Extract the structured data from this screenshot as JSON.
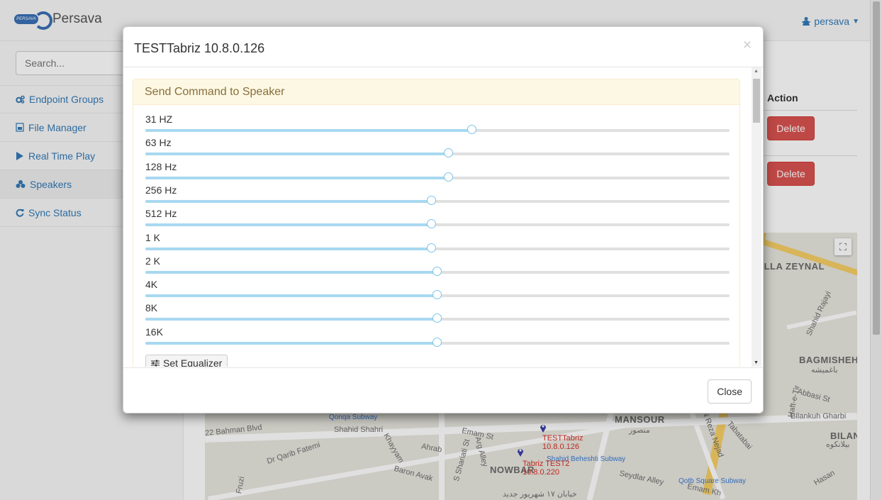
{
  "app": {
    "brand_logo_text": "PERSAVA",
    "brand_name": "Persava",
    "user": "persava"
  },
  "sidebar": {
    "search_placeholder": "Search...",
    "items": [
      {
        "label": "Endpoint Groups",
        "icon": "cogs-icon"
      },
      {
        "label": "File Manager",
        "icon": "file-icon"
      },
      {
        "label": "Real Time Play",
        "icon": "play-icon"
      },
      {
        "label": "Speakers",
        "icon": "speaker-icon",
        "active": true
      },
      {
        "label": "Sync Status",
        "icon": "refresh-icon"
      }
    ]
  },
  "table": {
    "action_header": "Action",
    "delete_label": "Delete"
  },
  "map": {
    "labels": [
      "OLLA ZEYNAL",
      "Shahid Rajayi",
      "BAGMISHEH",
      "باغمیشه",
      "Abbasi St",
      "Haft-e-Tir",
      "Bilankuh Gharbi",
      "BILANKI",
      "بیلانکوه",
      "MANSOUR",
      "منصور",
      "N Reza Nejad",
      "Tabatabai",
      "22 Bahman Blvd",
      "Shahid Shahri",
      "Dr Qarib Fatemi",
      "Khayyam",
      "Ahrab",
      "Emam St",
      "S Shariati St",
      "Arg Alley",
      "Baron Avak",
      "NOWBAR",
      "Seydlar Alley",
      "Emam Kh",
      "Hasan",
      "Fruzi",
      "خیابان ۱۷ شهریور جدید"
    ],
    "subways": [
      "Qonqa Subway",
      "Shahid Beheshti Subway",
      "Qotb Square Subway"
    ],
    "markers": [
      {
        "name": "TESTTabriz",
        "ip": "10.8.0.126"
      },
      {
        "name": "Tabriz TEST2",
        "ip": "10.8.0.220"
      }
    ]
  },
  "modal": {
    "title": "TESTTabriz 10.8.0.126",
    "close_x": "×",
    "panel_title": "Send Command to Speaker",
    "bands": [
      {
        "label": "31 HZ",
        "value": 0.56
      },
      {
        "label": "63 Hz",
        "value": 0.52
      },
      {
        "label": "128 Hz",
        "value": 0.52
      },
      {
        "label": "256 Hz",
        "value": 0.49
      },
      {
        "label": "512 Hz",
        "value": 0.49
      },
      {
        "label": "1 K",
        "value": 0.49
      },
      {
        "label": "2 K",
        "value": 0.5
      },
      {
        "label": "4K",
        "value": 0.5
      },
      {
        "label": "8K",
        "value": 0.5
      },
      {
        "label": "16K",
        "value": 0.5
      }
    ],
    "set_button": "Set Equalizer",
    "close_button": "Close"
  },
  "colors": {
    "link": "#337ab7",
    "danger": "#d9534f",
    "panel_warning_bg": "#fcf8e3",
    "slider_fill": "#a8d8f0"
  }
}
